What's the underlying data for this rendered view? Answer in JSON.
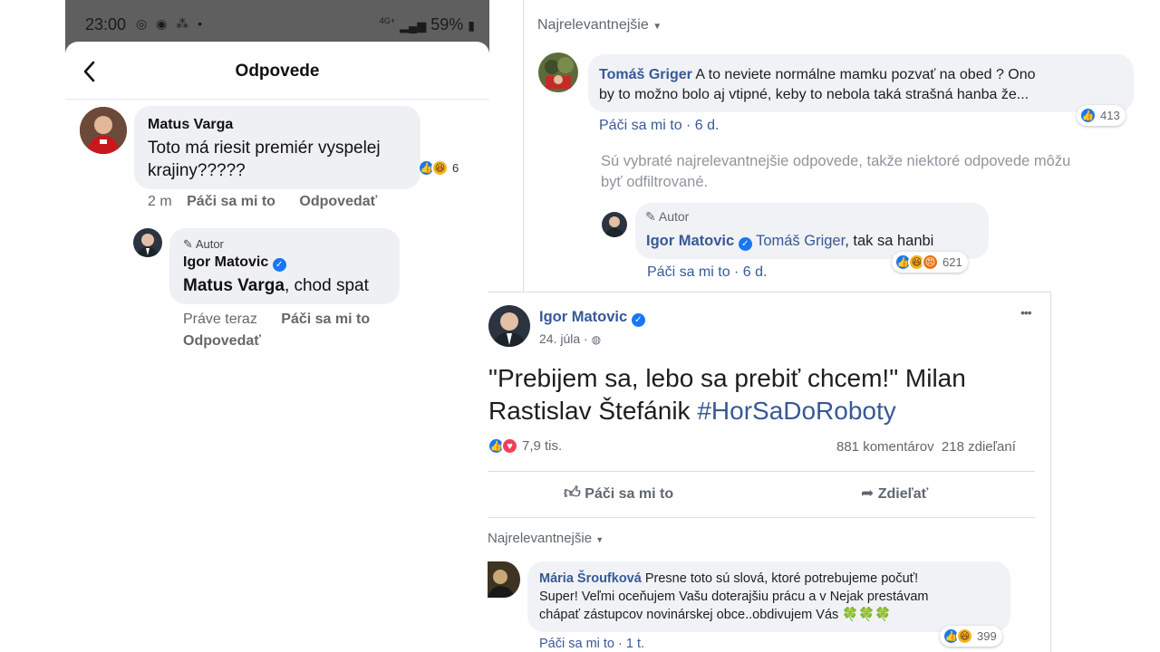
{
  "phone": {
    "status": {
      "time": "23:00",
      "net": "4G+",
      "battery": "59%"
    },
    "header_title": "Odpovede",
    "comment": {
      "author": "Matus Varga",
      "text": "Toto má riesit premiér vyspelej krajiny?????",
      "reaction_count": "6",
      "time": "2 m",
      "like": "Páči sa mi to",
      "reply": "Odpovedať"
    },
    "reply": {
      "badge": "Autor",
      "author": "Igor Matovic",
      "mention": "Matus Varga",
      "text": ", chod spat",
      "time": "Práve teraz",
      "like": "Páči sa mi to",
      "reply": "Odpovedať"
    }
  },
  "desktop_top": {
    "sort_label": "Najrelevantnejšie",
    "comment": {
      "author": "Tomáš Griger",
      "text_line1": "A to neviete normálne mamku pozvať na obed ? Ono",
      "text_line2": "by to možno bolo aj vtipné, keby to nebola taká strašná hanba že...",
      "reaction_count": "413",
      "meta": "Páči sa mi to · 6 d."
    },
    "filter_notice_line1": "Sú vybraté najrelevantnejšie odpovede, takže niektoré odpovede môžu",
    "filter_notice_line2": "byť odfiltrované.",
    "reply": {
      "badge": "Autor",
      "author": "Igor Matovic",
      "mention": "Tomáš Griger",
      "text": ", tak sa hanbi",
      "reaction_count": "621",
      "meta": "Páči sa mi to · 6 d."
    }
  },
  "post": {
    "author": "Igor Matovic",
    "date": "24. júla ·",
    "more": "•••",
    "text_line1": "\"Prebijem sa, lebo sa prebiť chcem!\" Milan",
    "text_line2_plain": "Rastislav Štefánik ",
    "hashtag": "#HorSaDoRoboty",
    "reactions": "7,9 tis.",
    "comments": "881 komentárov",
    "shares": "218 zdieľaní",
    "like_button": "Páči sa mi to",
    "share_button": "Zdieľať",
    "sort_label": "Najrelevantnejšie",
    "comment": {
      "author": "Mária Šroufková",
      "line1": "Presne toto sú slová, ktoré potrebujeme počuť!",
      "line2": "Super! Veľmi oceňujem Vašu doterajšiu prácu a v Nejak prestávam",
      "line3": "chápať zástupcov novinárskej obce..obdivujem Vás",
      "clovers": "🍀🍀🍀",
      "reaction_count": "399",
      "meta": "Páči sa mi to · 1 t."
    }
  }
}
